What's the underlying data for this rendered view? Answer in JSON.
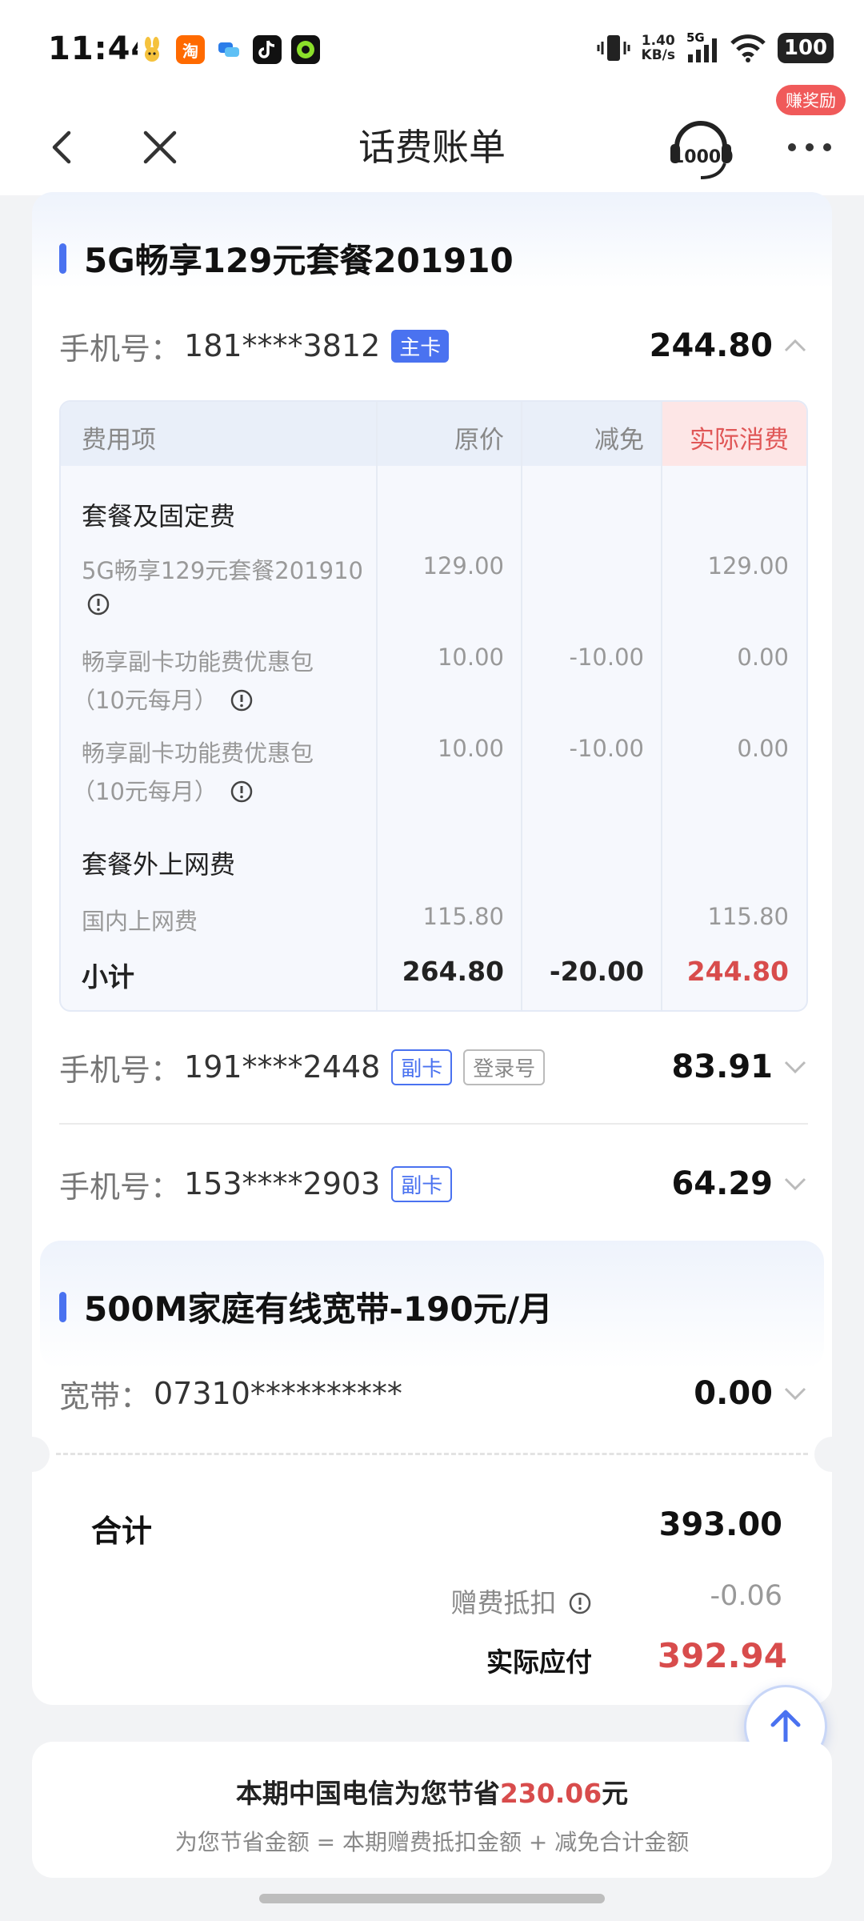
{
  "status_bar": {
    "time": "11:44",
    "speed_value": "1.40",
    "speed_unit": "KB/s",
    "network": "5G",
    "battery": "100"
  },
  "nav": {
    "title": "话费账单",
    "reward_badge": "赚奖励",
    "logo_text": "10000"
  },
  "plan": {
    "title": "5G畅享129元套餐201910",
    "main_phone": {
      "label": "手机号：",
      "number": "181****3812",
      "tag": "主卡",
      "amount": "244.80"
    },
    "table": {
      "headers": [
        "费用项",
        "原价",
        "减免",
        "实际消费"
      ],
      "group1_label": "套餐及固定费",
      "rows": [
        {
          "name": "5G畅享129元套餐201910",
          "original": "129.00",
          "discount": "",
          "actual": "129.00"
        },
        {
          "name_line1": "畅享副卡功能费优惠包",
          "name_line2": "（10元每月）",
          "original": "10.00",
          "discount": "-10.00",
          "actual": "0.00"
        },
        {
          "name_line1": "畅享副卡功能费优惠包",
          "name_line2": "（10元每月）",
          "original": "10.00",
          "discount": "-10.00",
          "actual": "0.00"
        }
      ],
      "group2_label": "套餐外上网费",
      "internet_row": {
        "name": "国内上网费",
        "original": "115.80",
        "discount": "",
        "actual": "115.80"
      },
      "subtotal": {
        "label": "小计",
        "original": "264.80",
        "discount": "-20.00",
        "actual": "244.80"
      }
    },
    "sub_phones": [
      {
        "label": "手机号：",
        "number": "191****2448",
        "tag": "副卡",
        "extra_tag": "登录号",
        "amount": "83.91"
      },
      {
        "label": "手机号：",
        "number": "153****2903",
        "tag": "副卡",
        "amount": "64.29"
      }
    ]
  },
  "broadband": {
    "title": "500M家庭有线宽带-190元/月",
    "label": "宽带：",
    "account": "07310**********",
    "amount": "0.00"
  },
  "summary": {
    "total_label": "合计",
    "total_value": "393.00",
    "gift_label": "赠费抵扣",
    "gift_value": "-0.06",
    "pay_label": "实际应付",
    "pay_value": "392.94"
  },
  "savings": {
    "prefix": "本期中国电信为您节省",
    "amount": "230.06",
    "suffix": "元",
    "note": "为您节省金额 = 本期赠费抵扣金额 + 减免合计金额"
  },
  "colors": {
    "accent": "#4a72f0",
    "highlight_red": "#d84c4c"
  }
}
